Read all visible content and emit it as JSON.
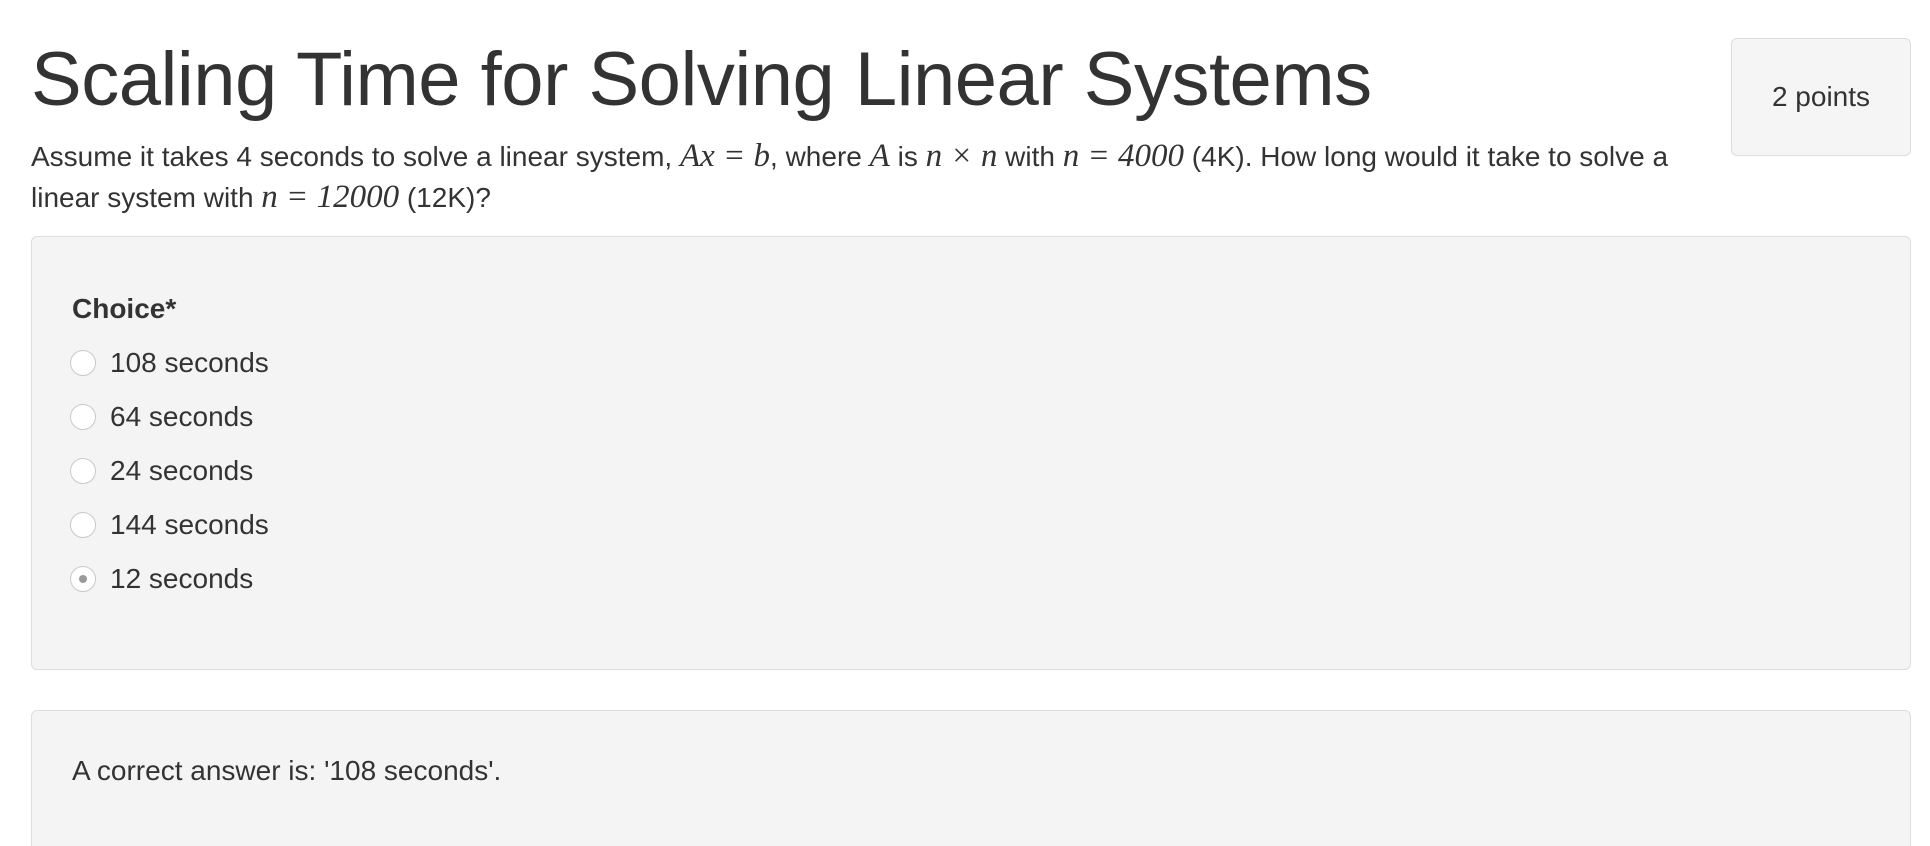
{
  "question": {
    "title": "Scaling Time for Solving Linear Systems",
    "points": "2 points",
    "prompt_parts": {
      "p1": "Assume it takes 4 seconds to solve a linear system, ",
      "m1": "Ax = b",
      "p2": ", where ",
      "m2": "A",
      "p3": " is ",
      "m3": "n × n",
      "p4": " with ",
      "m4": "n = 4000",
      "p5": " (4K). How long would it take to solve a linear system with ",
      "m5": "n = 12000",
      "p6": " (12K)?"
    }
  },
  "choices": {
    "label": "Choice*",
    "options": [
      {
        "label": "108 seconds",
        "selected": false
      },
      {
        "label": "64 seconds",
        "selected": false
      },
      {
        "label": "24 seconds",
        "selected": false
      },
      {
        "label": "144 seconds",
        "selected": false
      },
      {
        "label": "12 seconds",
        "selected": true
      }
    ]
  },
  "feedback": {
    "text": "A correct answer is: '108 seconds'."
  }
}
